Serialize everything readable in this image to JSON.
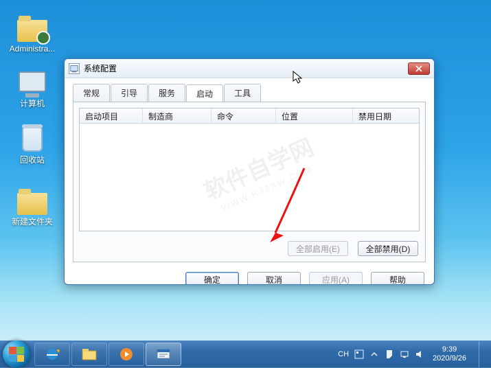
{
  "desktop_icons": {
    "admin": "Administra...",
    "computer": "计算机",
    "recycle": "回收站",
    "folder": "新建文件夹"
  },
  "window": {
    "title": "系统配置",
    "tabs": [
      "常规",
      "引导",
      "服务",
      "启动",
      "工具"
    ],
    "active_tab_index": 3,
    "columns": [
      "启动项目",
      "制造商",
      "命令",
      "位置",
      "禁用日期"
    ],
    "buttons": {
      "enable_all": "全部启用(E)",
      "disable_all": "全部禁用(D)",
      "ok": "确定",
      "cancel": "取消",
      "apply": "应用(A)",
      "help": "帮助"
    }
  },
  "watermark": {
    "main": "软件自学网",
    "sub": "WWW.RJZXW.COM"
  },
  "taskbar": {
    "ime": "CH",
    "time": "9:39",
    "date": "2020/9/26"
  }
}
